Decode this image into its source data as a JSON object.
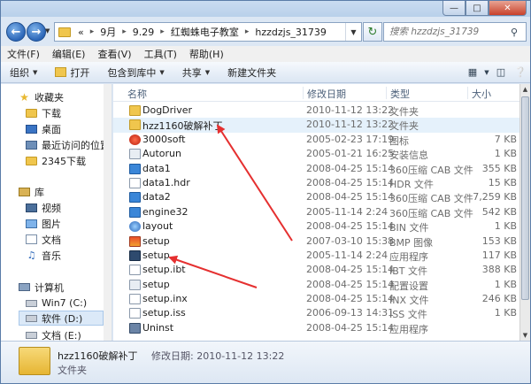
{
  "window": {
    "controls": [
      "—",
      "□",
      "✕"
    ]
  },
  "address": {
    "overflow": "«",
    "crumbs": [
      "9月",
      "9.29",
      "红蜘蛛电子教室",
      "hzzdzjs_31739"
    ],
    "separator": "▸",
    "search_placeholder": "搜索 hzzdzjs_31739"
  },
  "menu": [
    "文件(F)",
    "编辑(E)",
    "查看(V)",
    "工具(T)",
    "帮助(H)"
  ],
  "toolbar": {
    "organize": "组织",
    "open": "打开",
    "include": "包含到库中",
    "share": "共享",
    "newfolder": "新建文件夹"
  },
  "sidebar": {
    "favorites": "收藏夹",
    "downloads": "下载",
    "desktop": "桌面",
    "recent": "最近访问的位置",
    "dl2345": "2345下载",
    "libraries": "库",
    "videos": "视频",
    "pictures": "图片",
    "documents": "文档",
    "music": "音乐",
    "computer": "计算机",
    "drive_c": "Win7 (C:)",
    "drive_d": "软件 (D:)",
    "drive_e": "文档 (E:)"
  },
  "columns": {
    "name": "名称",
    "date": "修改日期",
    "type": "类型",
    "size": "大小"
  },
  "files": [
    {
      "name": "DogDriver",
      "date": "2010-11-12 13:22",
      "type": "文件夹",
      "size": "",
      "icon": "folder-icon"
    },
    {
      "name": "hzz1160破解补丁",
      "date": "2010-11-12 13:22",
      "type": "文件夹",
      "size": "",
      "icon": "folder-icon"
    },
    {
      "name": "3000soft",
      "date": "2005-02-23 17:19",
      "type": "图标",
      "size": "7 KB",
      "icon": "red-app-icon"
    },
    {
      "name": "Autorun",
      "date": "2005-01-21 16:25",
      "type": "安装信息",
      "size": "1 KB",
      "icon": "gear-file-icon"
    },
    {
      "name": "data1",
      "date": "2008-04-25 15:14",
      "type": "360压缩 CAB 文件",
      "size": "355 KB",
      "icon": "cab-icon"
    },
    {
      "name": "data1.hdr",
      "date": "2008-04-25 15:14",
      "type": "HDR 文件",
      "size": "15 KB",
      "icon": "file-icon"
    },
    {
      "name": "data2",
      "date": "2008-04-25 15:14",
      "type": "360压缩 CAB 文件",
      "size": "7,259 KB",
      "icon": "cab-icon"
    },
    {
      "name": "engine32",
      "date": "2005-11-14 2:24",
      "type": "360压缩 CAB 文件",
      "size": "542 KB",
      "icon": "cab-icon"
    },
    {
      "name": "layout",
      "date": "2008-04-25 15:14",
      "type": "BIN 文件",
      "size": "1 KB",
      "icon": "globe-icon"
    },
    {
      "name": "setup",
      "date": "2007-03-10 15:38",
      "type": "BMP 图像",
      "size": "153 KB",
      "icon": "bmp-icon"
    },
    {
      "name": "setup",
      "date": "2005-11-14 2:24",
      "type": "应用程序",
      "size": "117 KB",
      "icon": "setup-exe-icon"
    },
    {
      "name": "setup.ibt",
      "date": "2008-04-25 15:14",
      "type": "IBT 文件",
      "size": "388 KB",
      "icon": "file-icon"
    },
    {
      "name": "setup",
      "date": "2008-04-25 15:14",
      "type": "配置设置",
      "size": "1 KB",
      "icon": "gear-file-icon"
    },
    {
      "name": "setup.inx",
      "date": "2008-04-25 15:14",
      "type": "INX 文件",
      "size": "246 KB",
      "icon": "file-icon"
    },
    {
      "name": "setup.iss",
      "date": "2006-09-13 14:31",
      "type": "ISS 文件",
      "size": "1 KB",
      "icon": "file-icon"
    },
    {
      "name": "Uninst",
      "date": "2008-04-25 15:14",
      "type": "应用程序",
      "size": "",
      "icon": "app-icon"
    }
  ],
  "details": {
    "name": "hzz1160破解补丁",
    "meta": "修改日期: 2010-11-12 13:22",
    "type": "文件夹"
  },
  "colors": {
    "arrow": "#e53030",
    "folder": "#f0c64d",
    "selection": "#e5f1fb"
  }
}
